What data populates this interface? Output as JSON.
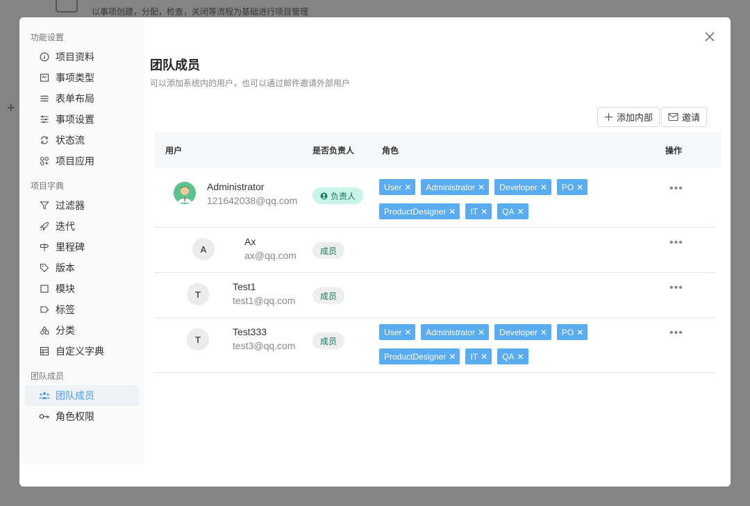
{
  "background": {
    "description": "以事项创建，分配，检查，关闭等流程为基础进行项目管理",
    "plus": "+"
  },
  "sidebar": {
    "groups": [
      {
        "title": "功能设置",
        "items": [
          {
            "label": "项目资料",
            "icon": "info-icon"
          },
          {
            "label": "事项类型",
            "icon": "issue-type-icon"
          },
          {
            "label": "表单布局",
            "icon": "form-layout-icon"
          },
          {
            "label": "事项设置",
            "icon": "settings-sliders-icon"
          },
          {
            "label": "状态流",
            "icon": "refresh-icon"
          },
          {
            "label": "项目应用",
            "icon": "apps-icon"
          }
        ]
      },
      {
        "title": "项目字典",
        "items": [
          {
            "label": "过滤器",
            "icon": "filter-icon"
          },
          {
            "label": "迭代",
            "icon": "rocket-icon"
          },
          {
            "label": "里程碑",
            "icon": "milestone-icon"
          },
          {
            "label": "版本",
            "icon": "tag-icon"
          },
          {
            "label": "模块",
            "icon": "module-icon"
          },
          {
            "label": "标签",
            "icon": "label-icon"
          },
          {
            "label": "分类",
            "icon": "category-icon"
          },
          {
            "label": "自定义字典",
            "icon": "table-icon"
          }
        ]
      },
      {
        "title": "团队成员",
        "items": [
          {
            "label": "团队成员",
            "icon": "team-icon",
            "active": true
          },
          {
            "label": "角色权限",
            "icon": "key-icon"
          }
        ]
      }
    ]
  },
  "main": {
    "title": "团队成员",
    "subtitle": "可以添加系统内的用户，也可以通过邮件邀请外部用户",
    "add_internal_label": "添加内部",
    "invite_label": "邀请"
  },
  "table": {
    "headers": {
      "user": "用户",
      "owner": "是否负责人",
      "role": "角色",
      "action": "操作"
    },
    "rows": [
      {
        "name": "Administrator",
        "email": "121642038@qq.com",
        "avatar": "",
        "badge": "负责人",
        "badge_type": "owner",
        "roles": [
          "User",
          "Administrator",
          "Developer",
          "PO",
          "ProductDesigner",
          "IT",
          "QA"
        ]
      },
      {
        "name": "Ax",
        "email": "ax@qq.com",
        "avatar": "A",
        "badge": "成员",
        "badge_type": "member",
        "roles": []
      },
      {
        "name": "Test1",
        "email": "test1@qq.com",
        "avatar": "T",
        "badge": "成员",
        "badge_type": "member",
        "roles": []
      },
      {
        "name": "Test333",
        "email": "test3@qq.com",
        "avatar": "T",
        "badge": "成员",
        "badge_type": "member",
        "roles": [
          "User",
          "Administrator",
          "Developer",
          "PO",
          "ProductDesigner",
          "IT",
          "QA"
        ]
      }
    ],
    "action_glyph": "•••"
  },
  "colors": {
    "accent": "#4a9ff5",
    "tag_bg": "#5aacf0",
    "owner_badge_bg": "#c9f4ea",
    "member_badge_bg": "#eeeeee"
  }
}
